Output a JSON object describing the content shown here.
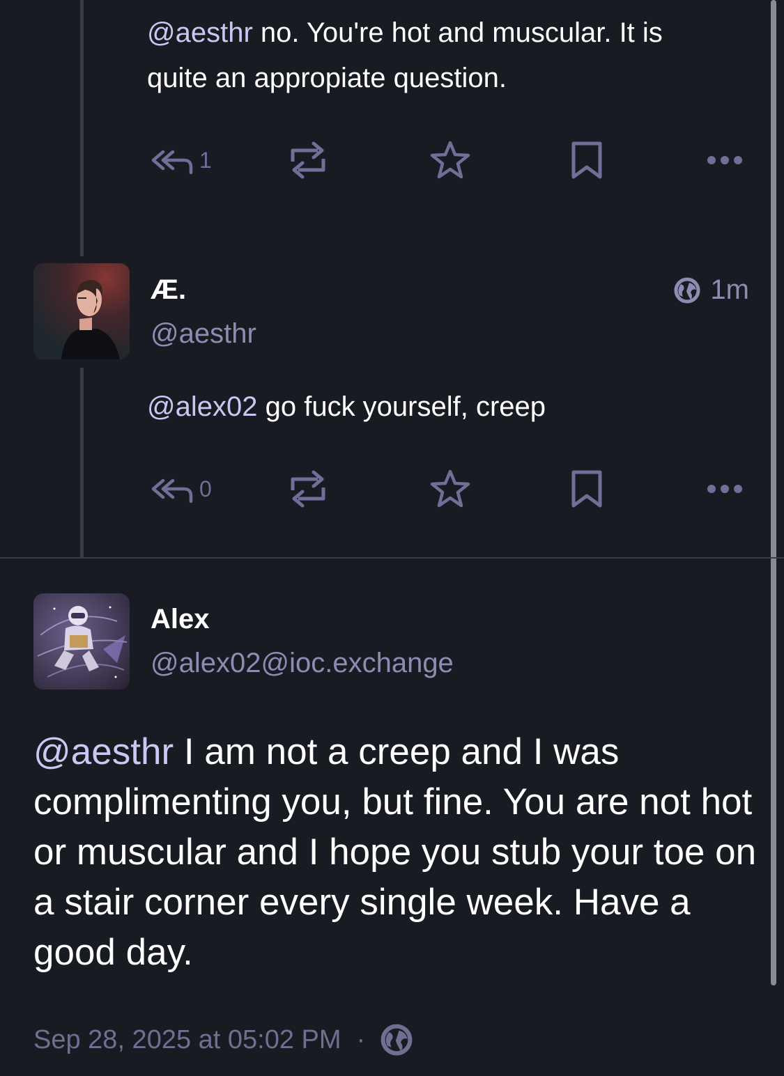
{
  "post1": {
    "mention": "@aesthr",
    "text_line1": " no. You're hot and muscular. It is",
    "text_line2": "quite an appropiate question.",
    "reply_count": "1"
  },
  "post2": {
    "display_name": "Æ.",
    "handle": "@aesthr",
    "time": "1m",
    "mention": "@alex02",
    "text": " go fuck yourself, creep",
    "reply_count": "0"
  },
  "main_post": {
    "display_name": "Alex",
    "handle": "@alex02@ioc.exchange",
    "mention": "@aesthr",
    "text": " I am not a creep and I was complimenting you, but fine. You are not hot or muscular and I hope you stub your toe on a stair corner every single week. Have a good day.",
    "timestamp": "Sep 28, 2025 at 05:02 PM",
    "separator": "·"
  },
  "icons": [
    "reply-all-icon",
    "boost-icon",
    "star-icon",
    "bookmark-icon",
    "more-icon",
    "globe-icon"
  ],
  "colors": {
    "background": "#191b22",
    "text": "#ffffff",
    "mention": "#c9c8f2",
    "muted": "#8c8db2",
    "icon": "#6f6f97",
    "thread_line": "#3a3b4a"
  }
}
